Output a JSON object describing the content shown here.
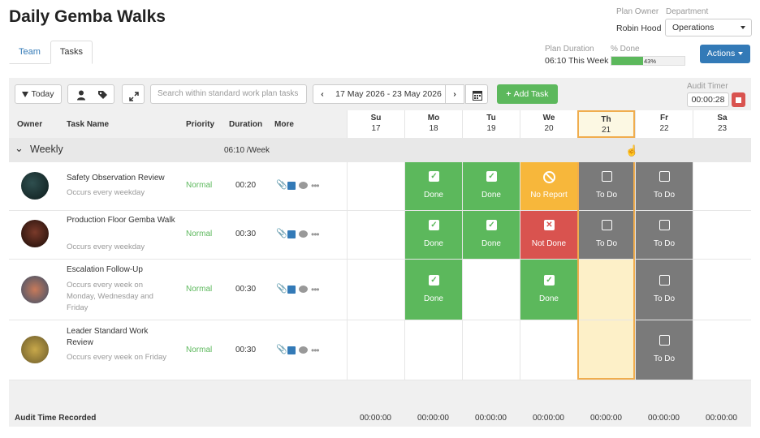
{
  "page": {
    "title": "Daily Gemba Walks"
  },
  "tabs": [
    {
      "label": "Team"
    },
    {
      "label": "Tasks"
    }
  ],
  "header": {
    "plan_owner_label": "Plan Owner",
    "plan_owner": "Robin Hood",
    "department_label": "Department",
    "department": "Operations",
    "plan_duration_label": "Plan Duration",
    "plan_duration": "06:10 This Week",
    "percent_done_label": "% Done",
    "percent_done_text": "43%",
    "percent_done_value": 0.43,
    "actions_label": "Actions"
  },
  "toolbar": {
    "today_label": "Today",
    "search_placeholder": "Search within standard work plan tasks",
    "date_range": "17 May 2026 - 23 May 2026",
    "add_task_label": "Add Task",
    "audit_timer_label": "Audit Timer",
    "audit_timer_value": "00:00:28"
  },
  "columns": {
    "owner": "Owner",
    "task_name": "Task Name",
    "priority": "Priority",
    "duration": "Duration",
    "more": "More"
  },
  "days": [
    {
      "name": "Su",
      "date": "17"
    },
    {
      "name": "Mo",
      "date": "18"
    },
    {
      "name": "Tu",
      "date": "19"
    },
    {
      "name": "We",
      "date": "20"
    },
    {
      "name": "Th",
      "date": "21"
    },
    {
      "name": "Fr",
      "date": "22"
    },
    {
      "name": "Sa",
      "date": "23"
    }
  ],
  "group": {
    "label": "Weekly",
    "duration": "06:10 /Week"
  },
  "tasks": [
    {
      "name": "Safety Observation Review",
      "schedule": "Occurs every weekday",
      "priority": "Normal",
      "duration": "00:20",
      "cells": [
        "",
        "Done",
        "Done",
        "No Report",
        "To Do",
        "To Do",
        ""
      ]
    },
    {
      "name": "Production Floor Gemba Walk",
      "schedule": "Occurs every weekday",
      "priority": "Normal",
      "duration": "00:30",
      "cells": [
        "",
        "Done",
        "Done",
        "Not Done",
        "To Do",
        "To Do",
        ""
      ]
    },
    {
      "name": "Escalation Follow-Up",
      "schedule": "Occurs every week on Monday, Wednesday and Friday",
      "priority": "Normal",
      "duration": "00:30",
      "cells": [
        "",
        "Done",
        "",
        "Done",
        "",
        "To Do",
        ""
      ]
    },
    {
      "name": "Leader Standard Work Review",
      "schedule": "Occurs every week on Friday",
      "priority": "Normal",
      "duration": "00:30",
      "cells": [
        "",
        "",
        "",
        "",
        "",
        "To Do",
        ""
      ]
    }
  ],
  "footer": {
    "label": "Audit Time Recorded",
    "values": [
      "00:00:00",
      "00:00:00",
      "00:00:00",
      "00:00:00",
      "00:00:00",
      "00:00:00",
      "00:00:00"
    ]
  },
  "colors": {
    "done": "#5cb85c",
    "no_report": "#f7b73b",
    "not_done": "#d9534f",
    "to_do": "#7a7a7a",
    "today_highlight": "#f0ad4e",
    "accent": "#337ab7"
  }
}
